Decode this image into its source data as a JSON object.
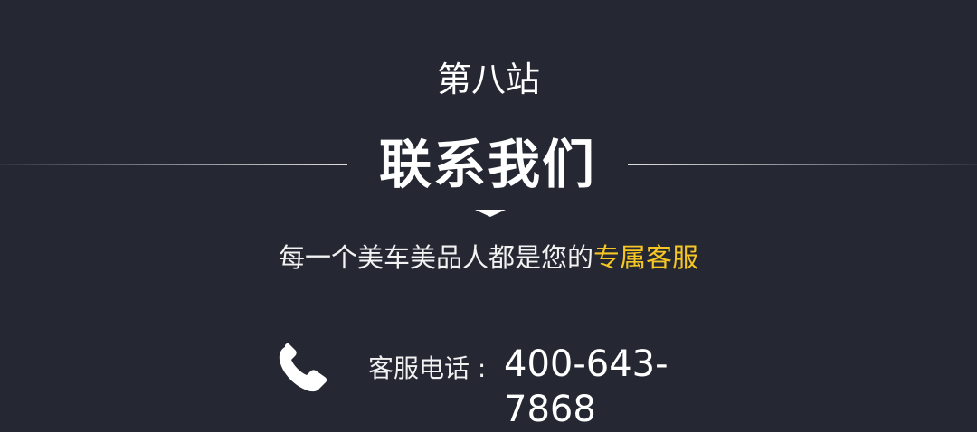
{
  "header": {
    "station": "第八站",
    "title": "联系我们"
  },
  "tagline": {
    "prefix": "每一个美车美品人都是您的",
    "highlight": "专属客服",
    "highlight_color": "#f6c624"
  },
  "contact": {
    "icon": "phone-icon",
    "label": "客服电话 :",
    "number": "400-643-7868"
  },
  "colors": {
    "background": "#252833",
    "text": "#ffffff"
  }
}
